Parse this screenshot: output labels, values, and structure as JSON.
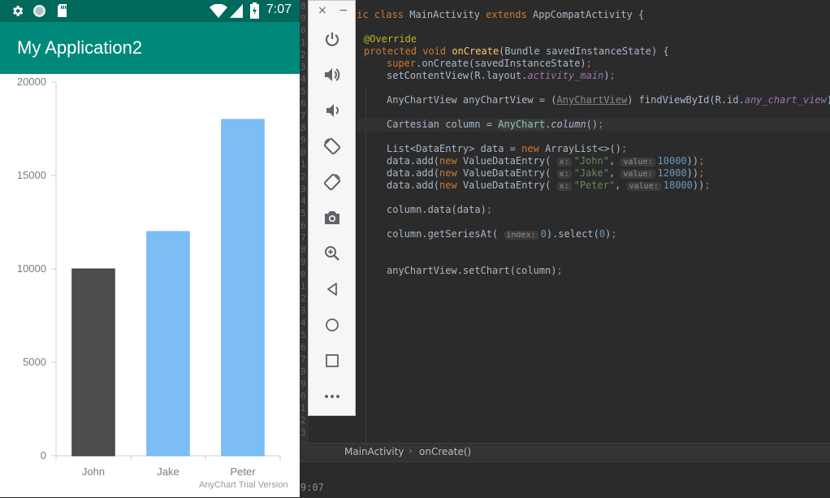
{
  "phone": {
    "status_time": "7:07",
    "app_title": "My Application2",
    "trial_text": "AnyChart Trial Version"
  },
  "chart_data": {
    "type": "bar",
    "categories": [
      "John",
      "Jake",
      "Peter"
    ],
    "values": [
      10000,
      12000,
      18000
    ],
    "ylim": [
      0,
      20000
    ],
    "yticks": [
      0,
      5000,
      10000,
      15000,
      20000
    ],
    "title": "",
    "xlabel": "",
    "ylabel": "",
    "grid": false,
    "colors": [
      "#4d4d4d",
      "#7dbdf5",
      "#7dbdf5"
    ],
    "selected_index": 0
  },
  "ide": {
    "breadcrumb": {
      "class_name": "MainActivity",
      "separator": "›",
      "method_name": "onCreate()"
    },
    "lower_time": "9:07",
    "gutter_lines": [
      "8",
      "9",
      "0",
      "1",
      "2",
      "3",
      "4",
      "5",
      "6",
      "7",
      "8",
      "9",
      "0",
      "1",
      "2",
      "3",
      "4",
      "5",
      "6",
      "7",
      "8",
      "9",
      "0",
      "1",
      "2",
      "3",
      "4",
      "5",
      "6",
      "7",
      "8",
      "9",
      "0",
      "1",
      "2",
      "3"
    ],
    "code": {
      "l1_kw": "lic class",
      "l1_name": " MainActivity ",
      "l1_ext": "extends",
      "l1_rest": " AppCompatActivity {",
      "l2_ann": "@Override",
      "l3_kw": "protected void ",
      "l3_fn": "onCreate",
      "l3_rest": "(Bundle savedInstanceState) {",
      "l4_kw": "super",
      "l4_mid": ".onCreate(savedInstanceState)",
      "l4_semi": ";",
      "l5_pre": "setContentView(R.layout.",
      "l5_it": "activity_main",
      "l5_post": ")",
      "l5_semi": ";",
      "l6_pre": "AnyChartView anyChartView = (",
      "l6_cast": "AnyChartView",
      "l6_mid": ") findViewById(R.id.",
      "l6_it": "any_chart_view",
      "l6_post": ")",
      "l6_semi": ";",
      "l7_pre": "Cartesian column = ",
      "l7_hl": "AnyChart",
      "l7_dot": ".",
      "l7_it": "column",
      "l7_post": "()",
      "l7_semi": ";",
      "l8_pre": "List<DataEntry> data = ",
      "l8_kw": "new",
      "l8_post": " ArrayList<>()",
      "l8_semi": ";",
      "entries": [
        {
          "name": "\"John\"",
          "value": "10000"
        },
        {
          "name": "\"Jake\"",
          "value": "12000"
        },
        {
          "name": "\"Peter\"",
          "value": "18000"
        }
      ],
      "entry_pre": "data.add(",
      "entry_kw": "new",
      "entry_cls": " ValueDataEntry( ",
      "hint_x": "x:",
      "hint_value": "value:",
      "entry_comma": ", ",
      "entry_close": "))",
      "entry_semi": ";",
      "l9_pre": "column.data(data)",
      "l9_semi": ";",
      "l10_pre": "column.getSeriesAt( ",
      "hint_index": "index:",
      "l10_n1": "0",
      "l10_mid": ").select(",
      "l10_n2": "0",
      "l10_post": ")",
      "l10_semi": ";",
      "l11_pre": "anyChartView.setChart(column)",
      "l11_semi": ";"
    }
  },
  "toolbar": {
    "close_label": "×",
    "minimize_label": "−",
    "buttons": [
      "power-icon",
      "volume-up-icon",
      "volume-down-icon",
      "rotate-left-icon",
      "rotate-right-icon",
      "camera-icon",
      "zoom-icon",
      "back-icon",
      "home-icon",
      "overview-icon",
      "more-icon"
    ]
  }
}
